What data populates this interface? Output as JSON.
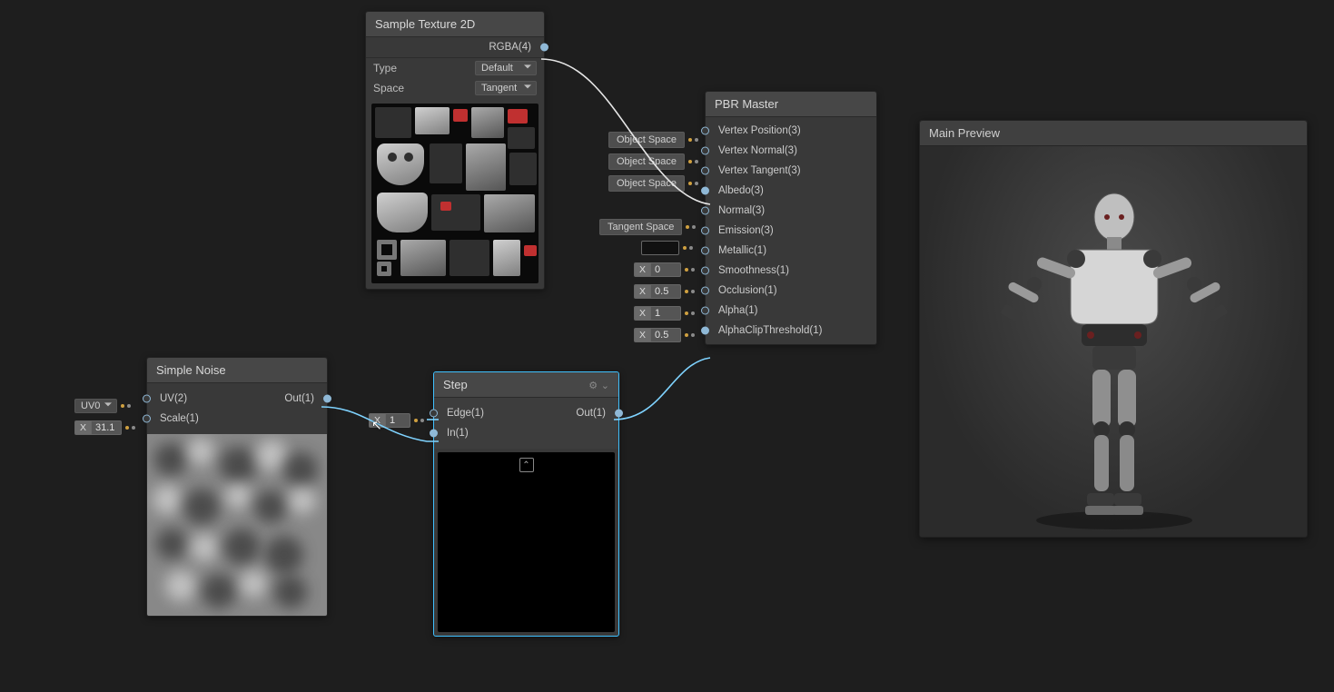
{
  "sample_texture": {
    "title": "Sample Texture 2D",
    "out_port": "RGBA(4)",
    "type_label": "Type",
    "type_value": "Default",
    "space_label": "Space",
    "space_value": "Tangent"
  },
  "simple_noise": {
    "title": "Simple Noise",
    "uv_label": "UV(2)",
    "scale_label": "Scale(1)",
    "out_label": "Out(1)",
    "uv_widget": "UV0",
    "scale_x": "X",
    "scale_value": "31.1"
  },
  "step": {
    "title": "Step",
    "edge_label": "Edge(1)",
    "in_label": "In(1)",
    "out_label": "Out(1)",
    "edge_x": "X",
    "edge_value": "1"
  },
  "pbr": {
    "title": "PBR Master",
    "space_labels": {
      "obj1": "Object Space",
      "obj2": "Object Space",
      "obj3": "Object Space",
      "tangent": "Tangent Space"
    },
    "inputs": {
      "vp": "Vertex Position(3)",
      "vn": "Vertex Normal(3)",
      "vt": "Vertex Tangent(3)",
      "albedo": "Albedo(3)",
      "normal": "Normal(3)",
      "emission": "Emission(3)",
      "metallic": "Metallic(1)",
      "smooth": "Smoothness(1)",
      "occl": "Occlusion(1)",
      "alpha": "Alpha(1)",
      "clip": "AlphaClipThreshold(1)"
    },
    "x": "X",
    "vals": {
      "metallic": "0",
      "smooth": "0.5",
      "occl": "1",
      "alpha": "0.5"
    }
  },
  "main_preview": {
    "title": "Main Preview"
  }
}
